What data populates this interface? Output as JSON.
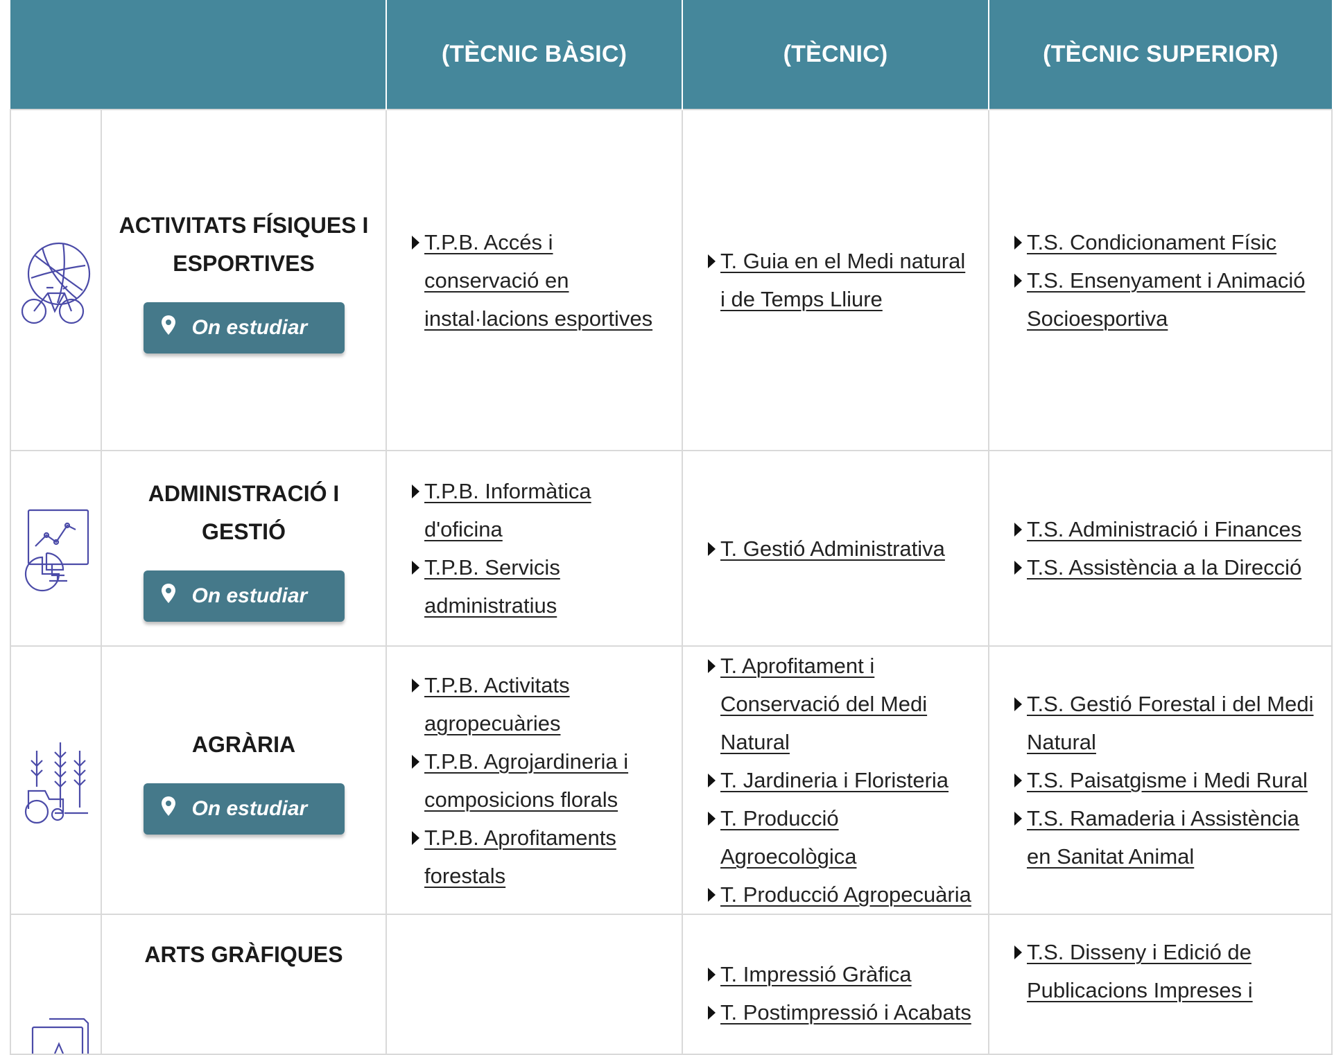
{
  "header": {
    "col_basic": "(TÈCNIC BÀSIC)",
    "col_mid": "(TÈCNIC)",
    "col_sup": "(TÈCNIC SUPERIOR)"
  },
  "button_label": "On estudiar",
  "families": [
    {
      "title_line1": "ACTIVITATS FÍSIQUES I",
      "title_line2": "ESPORTIVES",
      "icon": "sports-ball-bicycle-icon",
      "basic": [
        "T.P.B. Accés i conservació en instal·lacions esportives"
      ],
      "mid": [
        "T. Guia en el Medi natural i de Temps Lliure"
      ],
      "sup": [
        "T.S. Condicionament Físic",
        "T.S. Ensenyament i Animació Socioesportiva"
      ]
    },
    {
      "title_line1": "ADMINISTRACIÓ I GESTIÓ",
      "title_line2": "",
      "icon": "chart-monitor-icon",
      "basic": [
        "T.P.B. Informàtica d'oficina",
        "T.P.B. Servicis administratius"
      ],
      "mid": [
        "T. Gestió Administrativa"
      ],
      "sup": [
        "T.S. Administració i Finances",
        "T.S. Assistència a la Direcció"
      ]
    },
    {
      "title_line1": "AGRÀRIA",
      "title_line2": "",
      "icon": "tractor-wheat-icon",
      "basic": [
        "T.P.B. Activitats agropecuàries",
        "T.P.B. Agrojardineria i composicions florals",
        "T.P.B. Aprofitaments forestals"
      ],
      "mid": [
        "T. Aprofitament i Conservació del Medi Natural",
        "T. Jardineria i Floristeria",
        "T. Producció Agroecològica",
        "T. Producció Agropecuària"
      ],
      "sup": [
        "T.S. Gestió Forestal i del Medi Natural",
        "T.S. Paisatgisme i Medi Rural",
        "T.S. Ramaderia i Assistència en Sanitat Animal"
      ]
    },
    {
      "title_line1": "ARTS GRÀFIQUES",
      "title_line2": "",
      "icon": "printed-pages-icon",
      "basic": [],
      "mid": [
        "T. Impressió Gràfica",
        "T. Postimpressió i Acabats"
      ],
      "sup": [
        "T.S. Disseny i Edició de Publicacions Impreses i"
      ]
    }
  ]
}
